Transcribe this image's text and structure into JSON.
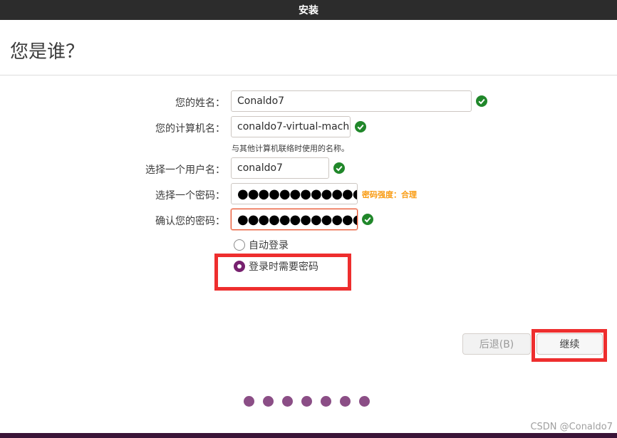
{
  "window": {
    "title": "安装"
  },
  "page": {
    "title": "您是谁？"
  },
  "form": {
    "name_label": "您的姓名：",
    "name_value": "Conaldo7",
    "computer_label": "您的计算机名：",
    "computer_value": "conaldo7-virtual-mach",
    "computer_hint": "与其他计算机联络时使用的名称。",
    "username_label": "选择一个用户名：",
    "username_value": "conaldo7",
    "password_label": "选择一个密码：",
    "password_value": "●●●●●●●●●●●●●",
    "password_strength": "密码强度：合理",
    "confirm_label": "确认您的密码：",
    "confirm_value": "●●●●●●●●●●●●●"
  },
  "login_options": {
    "auto_login_label": "自动登录",
    "require_password_label": "登录时需要密码",
    "selected": "require_password"
  },
  "buttons": {
    "back_label": "后退(B)",
    "continue_label": "继续"
  },
  "progress": {
    "total_steps": 7
  },
  "watermark": "CSDN @Conaldo7",
  "colors": {
    "titlebar": "#2c2c2c",
    "check": "#20872a",
    "radio_selected": "#77216f",
    "strength_text": "#f99b11",
    "focus_border": "#e9542f",
    "highlight": "#ee2e2e",
    "step_dot": "#8b4e86"
  },
  "icons": {
    "valid": "check-icon"
  }
}
